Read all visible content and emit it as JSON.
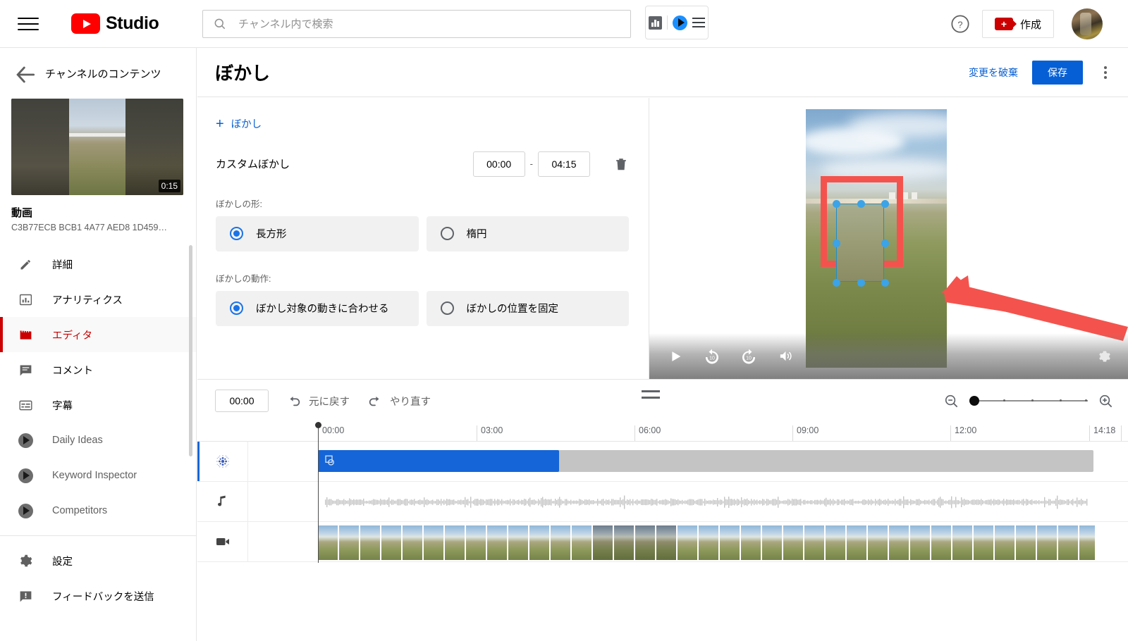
{
  "topbar": {
    "menu_icon": "hamburger-icon",
    "brand": "Studio",
    "search": {
      "placeholder": "チャンネル内で検索",
      "value": "",
      "icon": "search-icon"
    },
    "extension": {
      "chart_icon": "bar-chart-icon",
      "logo_icon": "vidiq-logo-icon",
      "menu_icon": "hamburger-icon"
    },
    "help_icon": "help-circle-icon",
    "create": {
      "label": "作成",
      "icon": "video-plus-icon"
    },
    "avatar": "account-avatar"
  },
  "sidebar": {
    "back_icon": "back-arrow-icon",
    "title": "チャンネルのコンテンツ",
    "thumbnail": {
      "duration": "0:15"
    },
    "video_label": "動画",
    "video_id": "C3B77ECB BCB1 4A77 AED8 1D459…",
    "items": [
      {
        "label": "詳細",
        "icon": "pencil-icon",
        "state": "normal"
      },
      {
        "label": "アナリティクス",
        "icon": "analytics-bar-icon",
        "state": "normal"
      },
      {
        "label": "エディタ",
        "icon": "clapperboard-icon",
        "state": "active"
      },
      {
        "label": "コメント",
        "icon": "comment-icon",
        "state": "normal"
      },
      {
        "label": "字幕",
        "icon": "subtitles-icon",
        "state": "normal"
      },
      {
        "label": "Daily Ideas",
        "icon": "vidiq-badge-icon",
        "state": "dim"
      },
      {
        "label": "Keyword Inspector",
        "icon": "vidiq-badge-icon",
        "state": "dim"
      },
      {
        "label": "Competitors",
        "icon": "vidiq-badge-icon",
        "state": "dim"
      }
    ],
    "items_bottom": [
      {
        "label": "設定",
        "icon": "gear-icon",
        "state": "normal"
      },
      {
        "label": "フィードバックを送信",
        "icon": "feedback-icon",
        "state": "normal"
      }
    ]
  },
  "main_header": {
    "title": "ぼかし",
    "discard_label": "変更を破棄",
    "save_label": "保存",
    "more_icon": "kebab-menu-icon"
  },
  "blur_panel": {
    "add_label": "ぼかし",
    "add_icon": "plus-icon",
    "row": {
      "name": "カスタムぼかし",
      "start_time": "00:00",
      "end_time": "04:15",
      "separator": "-",
      "delete_icon": "trash-icon"
    },
    "shape_label": "ぼかしの形:",
    "shape_options": [
      {
        "label": "長方形",
        "selected": true,
        "preview": "square-shape"
      },
      {
        "label": "楕円",
        "selected": false,
        "preview": "circle-shape"
      }
    ],
    "motion_label": "ぼかしの動作:",
    "motion_options": [
      {
        "label": "ぼかし対象の動きに合わせる",
        "selected": true
      },
      {
        "label": "ぼかしの位置を固定",
        "selected": false
      }
    ]
  },
  "preview": {
    "controls": [
      {
        "icon": "play-icon"
      },
      {
        "icon": "replay-10-icon",
        "label": "10"
      },
      {
        "icon": "forward-10-icon",
        "label": "10"
      },
      {
        "icon": "volume-icon"
      }
    ],
    "settings_icon": "gear-icon",
    "annotation_arrow": "red-arrow-annotation",
    "highlight_box": "red-highlight-box",
    "selection_box": "blur-selection-box"
  },
  "timeline": {
    "current_time": "00:00",
    "undo_label": "元に戻す",
    "undo_icon": "undo-icon",
    "redo_label": "やり直す",
    "redo_icon": "redo-icon",
    "drag_handle_icon": "drag-handle-icon",
    "zoom_out_icon": "zoom-out-icon",
    "zoom_in_icon": "zoom-in-icon",
    "zoom_value": 0,
    "ruler_labels": [
      "00:00",
      "03:00",
      "06:00",
      "09:00",
      "12:00",
      "14:18"
    ],
    "tracks": [
      {
        "icon": "blur-dots-icon",
        "name": "blur-track",
        "selected": true
      },
      {
        "icon": "music-note-icon",
        "name": "audio-track",
        "selected": false
      },
      {
        "icon": "video-camera-icon",
        "name": "video-track",
        "selected": false
      }
    ],
    "playhead_time": "00:00"
  }
}
